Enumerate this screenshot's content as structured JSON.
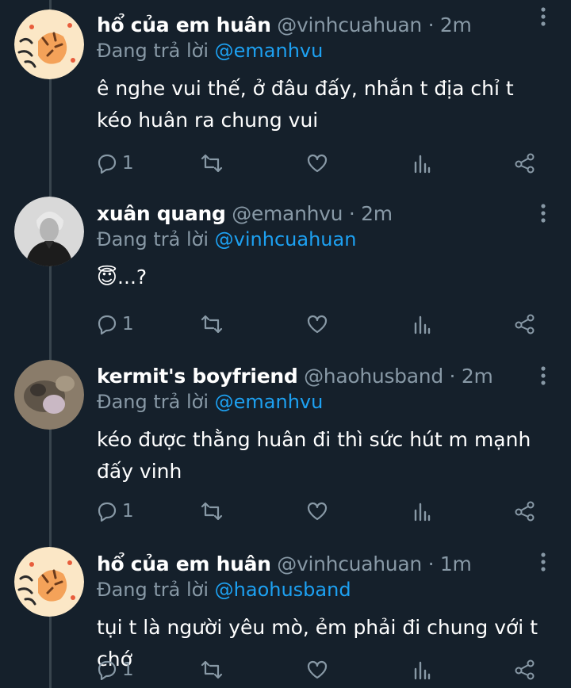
{
  "tweets": [
    {
      "name": "hổ của em huân",
      "handle": "@vinhcuahuan",
      "time": "· 2m",
      "reply_prefix": "Đang trả lời",
      "reply_to": "@emanhvu",
      "text": "ê nghe vui thế, ở đâu đấy, nhắn t địa chỉ t kéo huân ra chung vui",
      "reply_count": "1",
      "avatar": "tiger-avatar"
    },
    {
      "name": "xuân quang",
      "handle": "@emanhvu",
      "time": "· 2m",
      "reply_prefix": "Đang trả lời",
      "reply_to": "@vinhcuahuan",
      "text": "😇...?",
      "reply_count": "1",
      "avatar": "person-photo-avatar"
    },
    {
      "name": "kermit's boyfriend",
      "handle": "@haohusband",
      "time": "· 2m",
      "reply_prefix": "Đang trả lời",
      "reply_to": "@emanhvu",
      "text": "kéo được thằng huân đi thì sức hút m mạnh đấy vinh",
      "reply_count": "1",
      "avatar": "blurry-cat-avatar"
    },
    {
      "name": "hổ của em huân",
      "handle": "@vinhcuahuan",
      "time": "· 1m",
      "reply_prefix": "Đang trả lời",
      "reply_to": "@haohusband",
      "text": "tụi t là người yêu mò, ẻm phải đi chung với t chớ",
      "reply_count": "1",
      "avatar": "tiger-avatar"
    }
  ],
  "colors": {
    "background": "#15202b",
    "muted": "#8899a6",
    "link": "#1da1f2",
    "thread_line": "#38444d"
  },
  "icons": [
    "reply-icon",
    "retweet-icon",
    "like-icon",
    "analytics-icon",
    "share-icon",
    "more-icon"
  ]
}
